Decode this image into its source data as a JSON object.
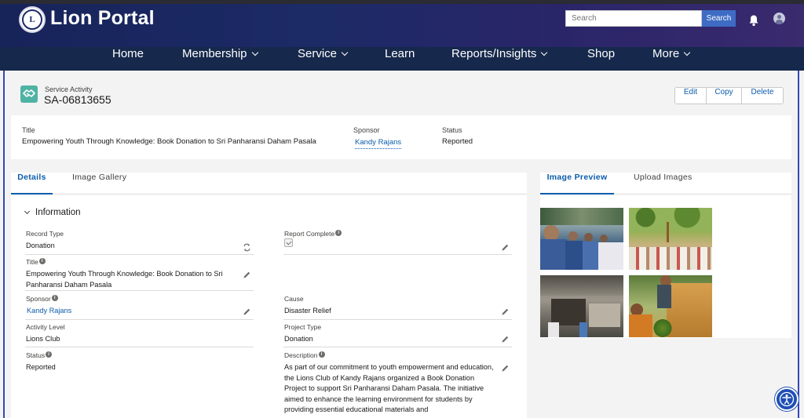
{
  "app": {
    "title": "Lion Portal",
    "logo_text": "L",
    "search": {
      "placeholder": "Search",
      "button_label": "Search"
    }
  },
  "nav": {
    "items": [
      {
        "label": "Home"
      },
      {
        "label": "Membership"
      },
      {
        "label": "Service"
      },
      {
        "label": "Learn"
      },
      {
        "label": "Reports/Insights"
      },
      {
        "label": "Shop"
      },
      {
        "label": "More"
      }
    ]
  },
  "record": {
    "object_label": "Service Activity",
    "id": "SA-06813655",
    "actions": {
      "edit": "Edit",
      "copy": "Copy",
      "delete": "Delete"
    }
  },
  "highlights": {
    "title_label": "Title",
    "title_value": "Empowering Youth Through Knowledge: Book Donation to Sri Panharansi Daham Pasala",
    "sponsor_label": "Sponsor",
    "sponsor_value": "Kandy Rajans",
    "status_label": "Status",
    "status_value": "Reported"
  },
  "details": {
    "tabs": {
      "details": "Details",
      "gallery": "Image Gallery"
    },
    "section_title": "Information",
    "fields": {
      "record_type": {
        "label": "Record Type",
        "value": "Donation"
      },
      "report_complete": {
        "label": "Report Complete",
        "checked": true
      },
      "title": {
        "label": "Title",
        "value": "Empowering Youth Through Knowledge: Book Donation to Sri Panharansi Daham Pasala"
      },
      "sponsor": {
        "label": "Sponsor",
        "value": "Kandy Rajans"
      },
      "cause": {
        "label": "Cause",
        "value": "Disaster Relief"
      },
      "activity_level": {
        "label": "Activity Level",
        "value": "Lions Club"
      },
      "project_type": {
        "label": "Project Type",
        "value": "Donation"
      },
      "status": {
        "label": "Status",
        "value": "Reported"
      },
      "description": {
        "label": "Description",
        "value": "As part of our commitment to youth empowerment and education, the Lions Club of Kandy Rajans organized a Book Donation Project to support Sri Panharansi Daham Pasala. The initiative aimed to enhance the learning environment for students by providing essential educational materials and"
      }
    }
  },
  "images": {
    "tabs": {
      "preview": "Image Preview",
      "upload": "Upload Images"
    }
  },
  "colors": {
    "brand_dark": "#16284c",
    "link": "#0b5cab",
    "accent_teal": "#4fb3a4"
  }
}
